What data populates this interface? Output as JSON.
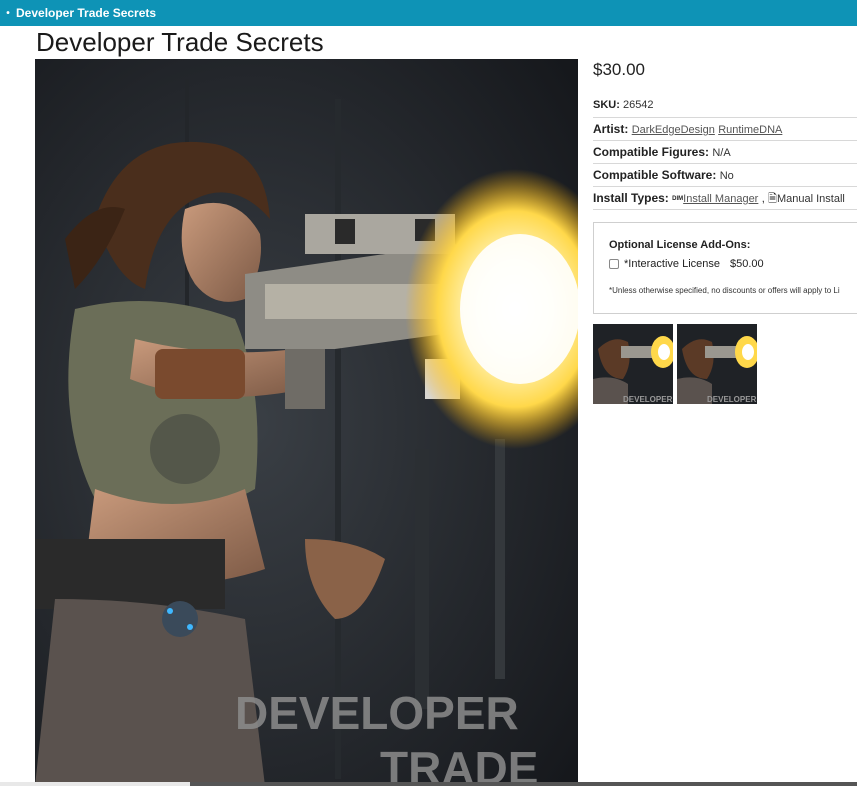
{
  "header": {
    "bullet": "•",
    "title": "Developer Trade Secrets"
  },
  "product": {
    "title": "Developer Trade Secrets",
    "price": "$30.00",
    "sku_label": "SKU:",
    "sku": "26542",
    "artist_label": "Artist:",
    "artists": [
      "DarkEdgeDesign",
      "RuntimeDNA"
    ],
    "figures_label": "Compatible Figures:",
    "figures": "N/A",
    "software_label": "Compatible Software:",
    "software": "No",
    "install_label": "Install Types:",
    "install_dim_icon": "DIM",
    "install_manager": "Install Manager",
    "install_sep": ",",
    "manual_install": "Manual Install",
    "cover_text_line1": "DEVELOPER",
    "cover_text_line2": "TRADE"
  },
  "addons": {
    "heading": "Optional License Add-Ons:",
    "option_label": "*Interactive License",
    "option_price": "$50.00",
    "note": "*Unless otherwise specified, no discounts or offers will apply to Li"
  },
  "thumbnails": [
    {
      "caption": "DEVELOPER"
    },
    {
      "caption": "DEVELOPER"
    }
  ],
  "colors": {
    "topbar": "#0e93b6",
    "muzzle_flash": "#ffd84a"
  }
}
